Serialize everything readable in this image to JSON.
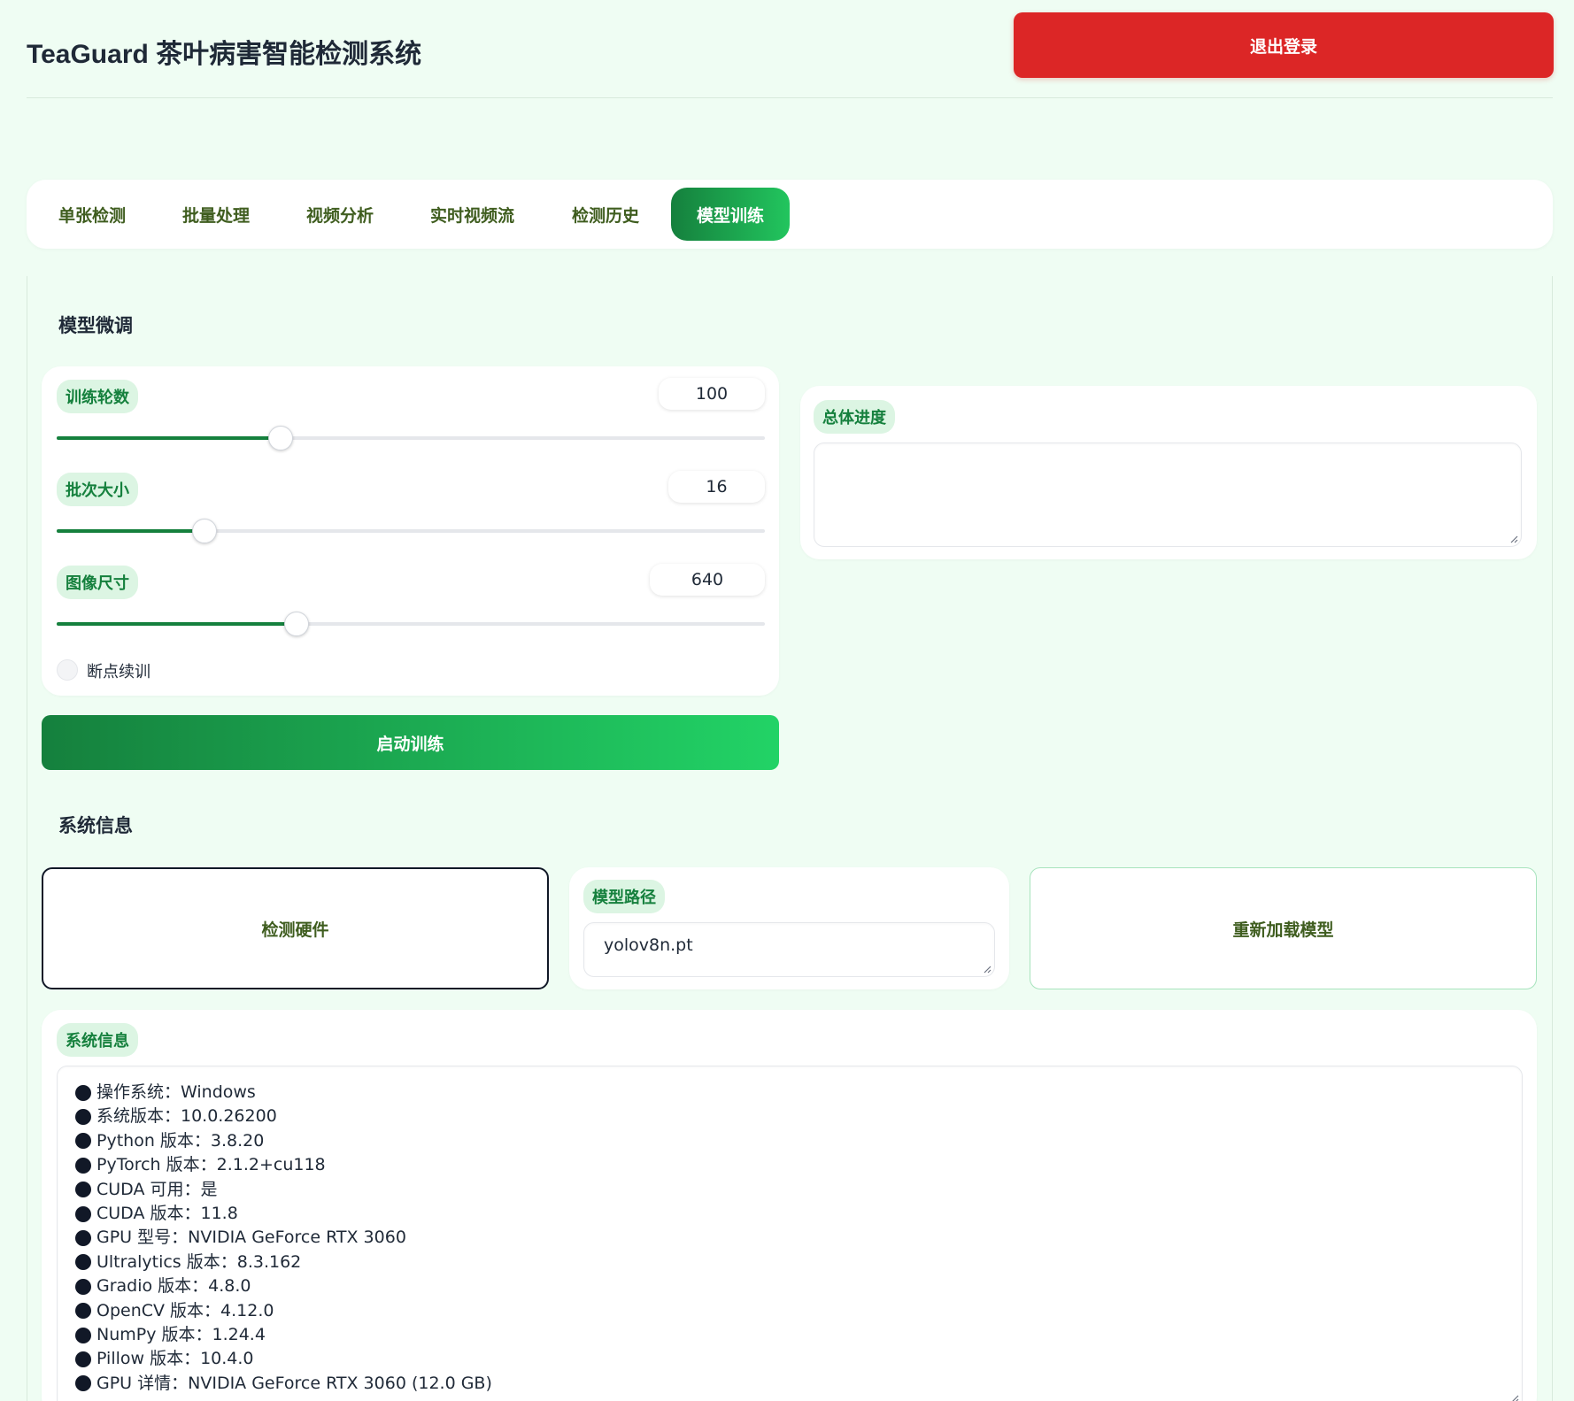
{
  "header": {
    "title": "TeaGuard 茶叶病害智能检测系统",
    "logout_label": "退出登录"
  },
  "tabs": [
    {
      "label": "单张检测",
      "active": false
    },
    {
      "label": "批量处理",
      "active": false
    },
    {
      "label": "视频分析",
      "active": false
    },
    {
      "label": "实时视频流",
      "active": false
    },
    {
      "label": "检测历史",
      "active": false
    },
    {
      "label": "模型训练",
      "active": true
    }
  ],
  "finetune": {
    "title": "模型微调",
    "epochs": {
      "label": "训练轮数",
      "value": "100",
      "fraction": 0.316
    },
    "batch": {
      "label": "批次大小",
      "value": "16",
      "fraction": 0.209
    },
    "imgsz": {
      "label": "图像尺寸",
      "value": "640",
      "fraction": 0.339
    },
    "resume_label": "断点续训",
    "resume_checked": false,
    "start_label": "启动训练",
    "progress_label": "总体进度",
    "progress_text": ""
  },
  "sysinfo": {
    "title": "系统信息",
    "detect_hw_label": "检测硬件",
    "model_path_label": "模型路径",
    "model_path_value": "yolov8n.pt",
    "reload_label": "重新加载模型",
    "info_label": "系统信息",
    "lines": [
      "操作系统：Windows",
      "系统版本：10.0.26200",
      "Python 版本：3.8.20",
      "PyTorch 版本：2.1.2+cu118",
      "CUDA 可用：是",
      "CUDA 版本：11.8",
      "GPU 型号：NVIDIA GeForce RTX 3060",
      "Ultralytics 版本：8.3.162",
      "Gradio 版本：4.8.0",
      "OpenCV 版本：4.12.0",
      "NumPy 版本：1.24.4",
      "Pillow 版本：10.4.0",
      "GPU 详情：NVIDIA GeForce RTX 3060 (12.0 GB)"
    ]
  },
  "colors": {
    "background": "#effdf3",
    "accent": "#15803d",
    "danger": "#dc2626"
  }
}
